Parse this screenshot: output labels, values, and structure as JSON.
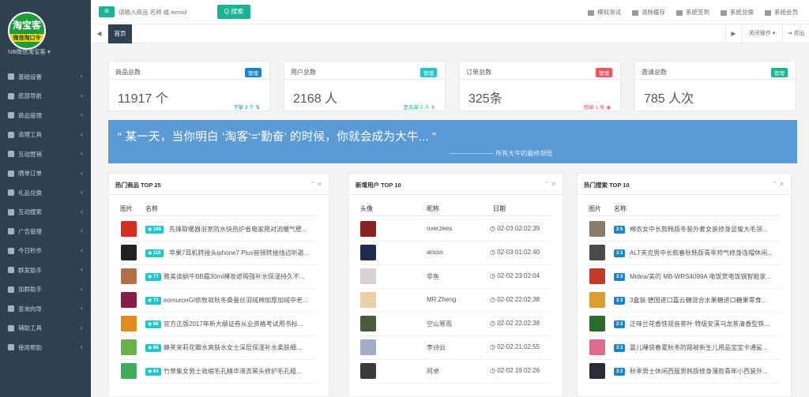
{
  "sidebar": {
    "logo_main": "淘宝客",
    "logo_sub": "微信淘口令",
    "site_name": "NB微信淘宝客",
    "items": [
      {
        "label": "基础设置"
      },
      {
        "label": "底部导航"
      },
      {
        "label": "商品管理"
      },
      {
        "label": "清理工具"
      },
      {
        "label": "互动营销"
      },
      {
        "label": "晒单订单"
      },
      {
        "label": "礼品兑换"
      },
      {
        "label": "互动搜索"
      },
      {
        "label": "广告管理"
      },
      {
        "label": "今日秒杀"
      },
      {
        "label": "群发助手"
      },
      {
        "label": "加群助手"
      },
      {
        "label": "查询向导"
      },
      {
        "label": "辅助工具"
      },
      {
        "label": "使用帮助"
      }
    ]
  },
  "topbar": {
    "search_placeholder": "请输入商品 名称 或 itemid",
    "search_button": "Q 搜索",
    "links": [
      "模拟测试",
      "清除缓存",
      "系统签到",
      "系统兑换",
      "系统会员"
    ]
  },
  "tabs": {
    "prev": "◀",
    "home": "首页",
    "next": "▶",
    "close_ops": "关闭操作 ▾",
    "exit": "⇥ 退出"
  },
  "stats": [
    {
      "title": "商品总数",
      "badge": "管理",
      "badge_color": "#1c84c6",
      "value": "11917 个",
      "sub": "下架 3 个 ⇅",
      "sub_color": "#1c84c6"
    },
    {
      "title": "用户总数",
      "badge": "管理",
      "badge_color": "#23c6c8",
      "value": "2168 人",
      "sub": "黑名单 0 人 ↯",
      "sub_color": "#1ab394"
    },
    {
      "title": "订单总数",
      "badge": "管理",
      "badge_color": "#ed5565",
      "value": "325条",
      "sub": "晒单 1 条 ◉",
      "sub_color": "#ed5565"
    },
    {
      "title": "邀请总数",
      "badge": "管理",
      "badge_color": "#1ab394",
      "value": "785 人次",
      "sub": "",
      "sub_color": "#1ab394"
    }
  ],
  "quote": {
    "text": "“ 某一天，当你明白 ‘淘客’=‘勤奋’ 的时候，你就会成为大牛... ”",
    "author": "———————     所有大牛的最终领悟"
  },
  "hot_products": {
    "title": "热门商品 TOP 25",
    "col_img": "图片",
    "col_name": "名称",
    "rows": [
      {
        "count": "◉ 169",
        "name": "先锋取暖器浴室防水快热炉省电家用对流暖气壁...",
        "color": "#d62d20"
      },
      {
        "count": "◉ 115",
        "name": "苹果7耳机转接头iphone7 Plus音频转接线边听歌...",
        "color": "#222222"
      },
      {
        "count": "◉ 77",
        "name": "雅美诶蜗牛BB霜30ml裸妆遮瑕强补水保湿持久不...",
        "color": "#b07048"
      },
      {
        "count": "◉ 73",
        "name": "eomuronG/依牧就秋冬桑蚕丝羽绒棉加厚加绒中老...",
        "color": "#8a1c4a"
      },
      {
        "count": "◉ 68",
        "name": "官方正版2017年新大纲证券从业资格考试用书标...",
        "color": "#e28a1a"
      },
      {
        "count": "◉ 65",
        "name": "静芙茉莉花瓣水爽肤水女士深层保湿补水柔肤细...",
        "color": "#6ab04c"
      },
      {
        "count": "◉ 64",
        "name": "竹草集女男士收缩毛孔精华液去黑头修护毛孔粗...",
        "color": "#3dae5b"
      }
    ]
  },
  "new_users": {
    "title": "新增用户 TOP 10",
    "col_avatar": "头像",
    "col_nick": "昵称",
    "col_date": "日期",
    "rows": [
      {
        "nick": "overzees",
        "date": "◷ 02-03 02:02:39",
        "color": "#8a2222"
      },
      {
        "nick": "ansss",
        "date": "◷ 02-03 01:02:40",
        "color": "#1f2b4a"
      },
      {
        "nick": "非鱼",
        "date": "◷ 02-02 23:02:04",
        "color": "#d9d0d6"
      },
      {
        "nick": "MR.Zheng",
        "date": "◷ 02-02 22:02:38",
        "color": "#e8cfa8"
      },
      {
        "nick": "空山寒雨",
        "date": "◷ 02-02 22:02:38",
        "color": "#4a5a3a"
      },
      {
        "nick": "李诗云",
        "date": "◷ 02-02 21:02:55",
        "color": "#a0aec8"
      },
      {
        "nick": "阿卓",
        "date": "◷ 02-02 19:02:26",
        "color": "#3a3a3a"
      }
    ]
  },
  "hot_searches": {
    "title": "热门搜索 TOP 10",
    "col_img": "图片",
    "col_name": "名称",
    "rows": [
      {
        "count": "3 5",
        "name": "棉衣女中长款韩版冬装外套女装修身显瘦大毛领...",
        "color": "#8a7a6a"
      },
      {
        "count": "3 3",
        "name": "ALT夹克男中长款春秋韩版青年帅气修身连帽休闲...",
        "color": "#4a4a4a"
      },
      {
        "count": "3 3",
        "name": "Midea/美的 MB-WRS4099A 电饭煲电饭锅智能家...",
        "color": "#c23a2a"
      },
      {
        "count": "3 3",
        "name": "3盒装 德国进口嘉云糖混合水果糖进口糖果零食...",
        "color": "#d9a030"
      },
      {
        "count": "3 3",
        "name": "正味兰花香铁观音茶叶 特级安溪乌龙茶清香型铁...",
        "color": "#2a6a2a"
      },
      {
        "count": "3 3",
        "name": "婴儿睡袋春夏秋冬防踢被新生儿用品宝宝卡通鲨...",
        "color": "#e06a8a"
      },
      {
        "count": "3 2",
        "name": "秋季男士休闲西服男韩版修身薄款青年小西装外...",
        "color": "#2a2a3a"
      }
    ]
  }
}
